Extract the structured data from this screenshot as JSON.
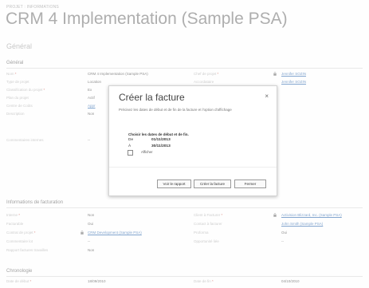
{
  "header": {
    "breadcrumb": "PROJET : INFORMATIONS",
    "title": "CRM 4 Implementation (Sample PSA)"
  },
  "general": {
    "section_title": "Général",
    "subsection": "Général",
    "rows": [
      {
        "l1": "Nom",
        "r1": true,
        "v1": "CRM 4 Implementation (Sample PSA)",
        "l2": "Chef de projet",
        "r2": true,
        "v2": "Jennifer SOZIN",
        "v2link": true,
        "lock2": true
      },
      {
        "l1": "Type de projet",
        "v1": "Location",
        "l2": "Accordataire",
        "v2": "Jennifer SOZIN",
        "v2link": true
      },
      {
        "l1": "Classification du projet",
        "r1": true,
        "v1": "Ex",
        "l2": "",
        "v2": ""
      },
      {
        "l1": "Plan du projet",
        "v1": "Actif",
        "l2": "",
        "v2": ""
      },
      {
        "l1": "Centre de Coûts",
        "v1": "Appr",
        "v1link": true,
        "l2": "",
        "v2": ""
      },
      {
        "l1": "Description",
        "v1": "Non",
        "l2": "",
        "v2": ""
      }
    ],
    "comments_label": "Commentaires internes",
    "comments_value": "--"
  },
  "billing": {
    "subsection": "Informations de facturation",
    "rows": [
      {
        "l1": "Interne",
        "r1": true,
        "v1": "Non",
        "l2": "Client à Facturer",
        "r2": true,
        "v2": "Activision Blizzard, Inc. (Sample PSA)",
        "v2link": true,
        "lock2": true
      },
      {
        "l1": "Facturable",
        "v1": "Oui",
        "l2": "Contact à facturer",
        "v2": "John Smith (Sample PSA)",
        "v2link": true
      },
      {
        "l1": "Contrat de projet",
        "r1": true,
        "v1": "CRM Development (Sample PSA)",
        "v1link": true,
        "lock1": true,
        "l2": "Proforma",
        "v2": "Oui"
      },
      {
        "l1": "Commentaire lot",
        "v1": "--",
        "l2": "Opportunité liée",
        "v2": "--"
      },
      {
        "l1": "Rapport factures travailles",
        "v1": "Non",
        "l2": "",
        "v2": ""
      }
    ]
  },
  "chronology": {
    "subsection": "Chronologie",
    "row": {
      "l1": "Date de début",
      "r1": true,
      "v1": "18/09/2010",
      "l2": "Date de fin",
      "r2": true,
      "v2": "04/10/2010"
    }
  },
  "dialog": {
    "title": "Créer la facture",
    "close": "×",
    "description": "Précisez les dates de début et de fin de la facture et l'option d'affichage",
    "choose_label": "Choisir les dates de début et de fin.",
    "from_label": "De",
    "from_value": "01/11/2013",
    "to_label": "À",
    "to_value": "30/11/2013",
    "checkbox_label": "Afficher",
    "buttons": {
      "view_report": "Voir le rapport",
      "create_invoice": "Créer la facture",
      "close": "Fermer"
    }
  },
  "icons": {
    "calendar": "calendar-icon",
    "lock": "lock-icon",
    "close": "close-icon"
  }
}
